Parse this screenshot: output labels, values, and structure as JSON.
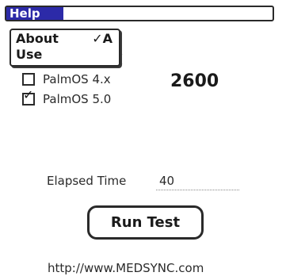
{
  "menubar": {
    "menu_title": "Help"
  },
  "dropdown": {
    "about_label": "About",
    "about_shortcut": "✓A",
    "use_label": "Use",
    "hidden_text_fragment": "("
  },
  "options": [
    {
      "label": "PalmOS 4.x",
      "checked": false
    },
    {
      "label": "PalmOS 5.0",
      "checked": true
    }
  ],
  "result": {
    "score": "2600"
  },
  "elapsed": {
    "label": "Elapsed Time",
    "value": "40"
  },
  "run_button": {
    "label": "Run Test"
  },
  "footer": {
    "url": "http://www.MEDSYNC.com"
  },
  "colors": {
    "menu_highlight": "#2c2aa8",
    "border": "#2a2a2a",
    "background": "#ffffff"
  }
}
